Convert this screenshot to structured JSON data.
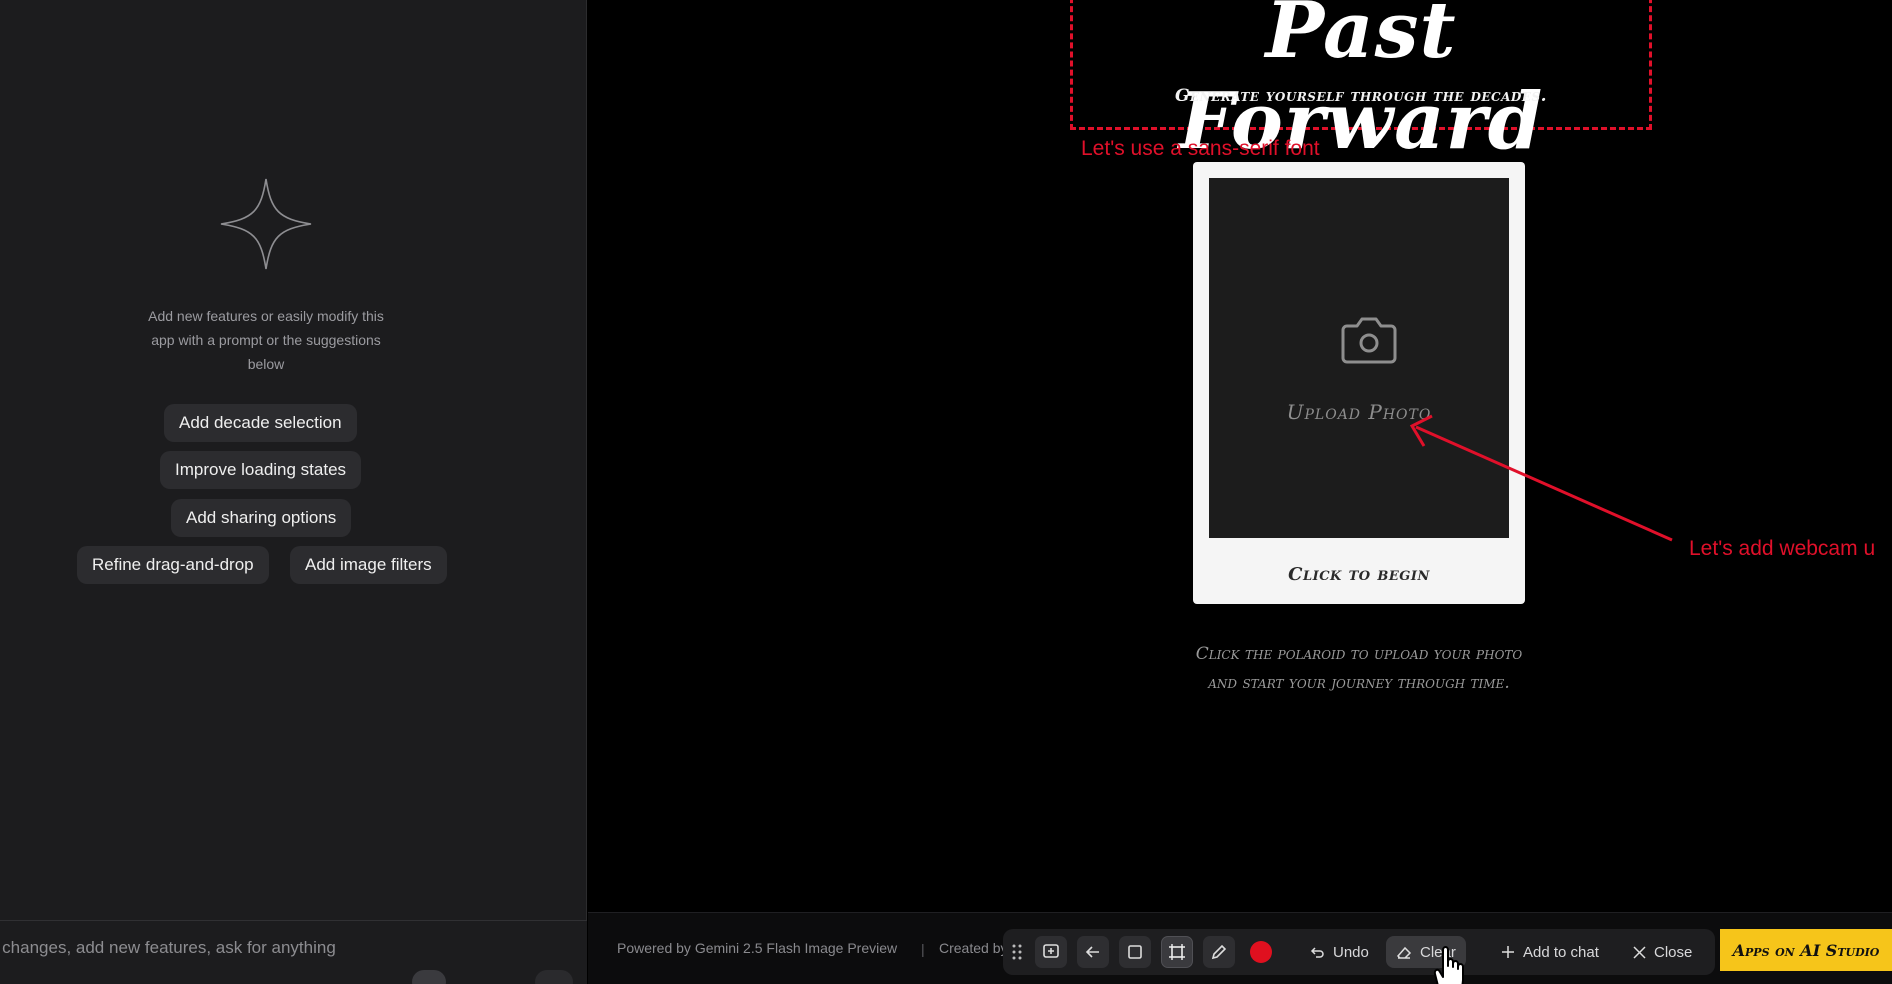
{
  "chat": {
    "intro_text": "Add new features or easily modify this app with a prompt or the suggestions below",
    "suggestions": [
      "Add decade selection",
      "Improve loading states",
      "Add sharing options",
      "Refine drag-and-drop",
      "Add image filters"
    ],
    "input_placeholder": "e changes, add new features, ask for anything"
  },
  "app": {
    "title": "Past Forward",
    "subtitle": "Generate yourself through the decades.",
    "upload_label": "Upload Photo",
    "polaroid_caption": "Click to begin",
    "instructions": "Click the polaroid to upload your photo and start your journey through time."
  },
  "annotations": {
    "font_note": "Let's use a sans-serif font",
    "webcam_note": "Let's add webcam u",
    "color": "#e0102a"
  },
  "footer": {
    "powered_by": "Powered by Gemini 2.5 Flash Image Preview",
    "separator": "|",
    "created_by": "Created by"
  },
  "toolbar": {
    "undo_label": "Undo",
    "clear_label": "Clear",
    "add_to_chat_label": "Add to chat",
    "close_label": "Close",
    "record_color": "#e0101f",
    "icons": [
      "drag-handle-icon",
      "add-comment-icon",
      "back-arrow-icon",
      "rectangle-icon",
      "select-frame-icon",
      "pen-icon",
      "record-icon",
      "undo-icon",
      "eraser-icon",
      "plus-icon",
      "close-icon"
    ]
  },
  "studio_button_label": "Apps on AI Studio",
  "colors": {
    "panel_bg": "#1c1c1e",
    "accent_yellow": "#f6c51a",
    "annotation_red": "#e0102a"
  }
}
